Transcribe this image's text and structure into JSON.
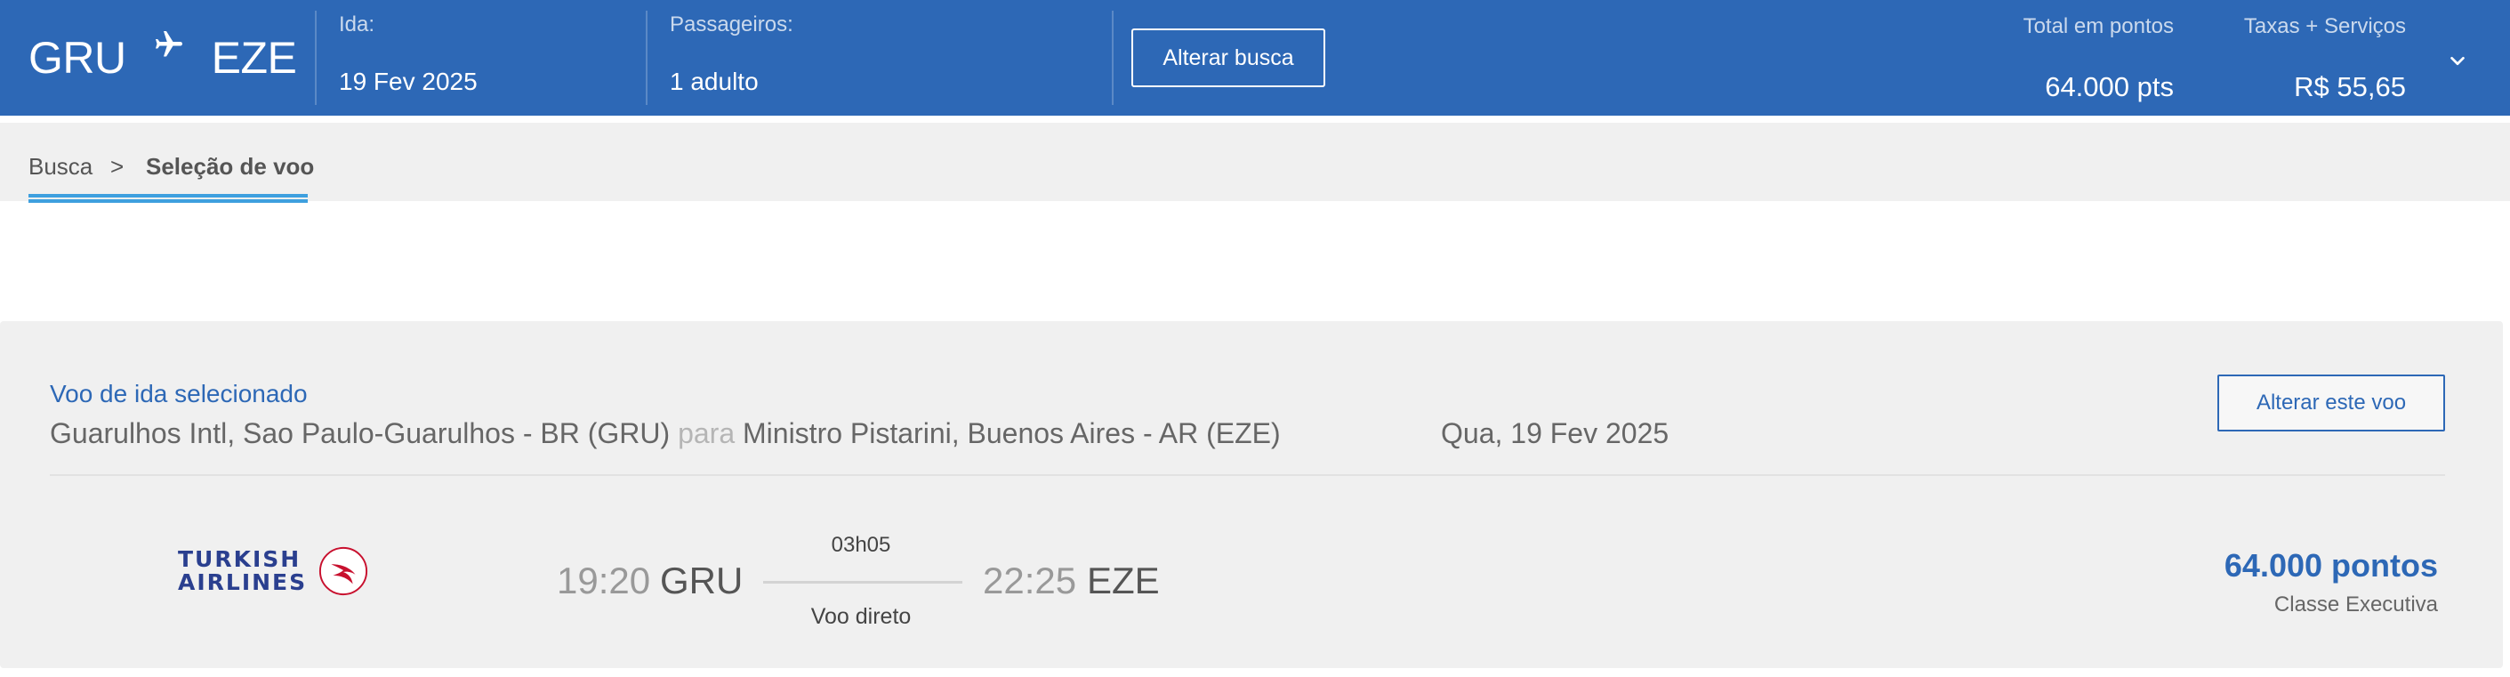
{
  "header": {
    "origin": "GRU",
    "destination": "EZE",
    "departure_label": "Ida:",
    "departure_value": "19 Fev 2025",
    "passengers_label": "Passageiros:",
    "passengers_value": "1 adulto",
    "alter_search_label": "Alterar busca",
    "total_points_label": "Total em pontos",
    "total_points_value": "64.000 pts",
    "taxes_label": "Taxas + Serviços",
    "taxes_value": "R$ 55,65"
  },
  "breadcrumb": {
    "items": [
      "Busca",
      "Seleção de voo"
    ],
    "separator": ">",
    "active_color": "#3ea0df"
  },
  "selected_flight": {
    "title": "Voo de ida selecionado",
    "origin_full": "Guarulhos Intl, Sao Paulo-Guarulhos - BR (GRU)",
    "connector": "para",
    "destination_full": "Ministro Pistarini, Buenos Aires - AR (EZE)",
    "date": "Qua, 19 Fev 2025",
    "alter_flight_label": "Alterar este voo",
    "airline_line1": "TURKISH",
    "airline_line2": "AIRLINES",
    "departure_time": "19:20",
    "departure_airport": "GRU",
    "duration": "03h05",
    "stops": "Voo direto",
    "arrival_time": "22:25",
    "arrival_airport": "EZE",
    "points": "64.000 pontos",
    "cabin": "Classe Executiva"
  },
  "colors": {
    "header_bg": "#2d68b6",
    "panel_bg": "#f0f0f0",
    "accent_blue": "#2d68b6",
    "airline_logo_red": "#c8102e"
  },
  "icons": {
    "plane": "airplane-icon",
    "chevron": "chevron-down-icon",
    "airline_logo": "turkish-airlines-logo"
  }
}
